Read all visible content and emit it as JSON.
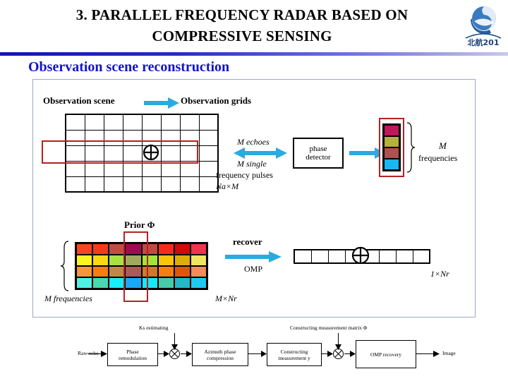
{
  "header": {
    "title_line1": "3. PARALLEL FREQUENCY RADAR BASED ON",
    "title_line2": "COMPRESSIVE SENSING",
    "logo_text": "北航201",
    "logo_name": "beihang-logo",
    "rule_color": "#1414b4"
  },
  "section": {
    "heading": "Observation scene reconstruction",
    "heading_color": "#1414c8"
  },
  "diagram": {
    "labels": {
      "observation_scene": "Observation scene",
      "observation_grids": "Observation grids",
      "m_echoes": "M  echoes",
      "m_single": "M  single",
      "frequency_pulses": "frequency pulses",
      "na_x_m": "Na×M",
      "phase_detector_line1": "phase",
      "phase_detector_line2": "detector",
      "m_frequencies_top": "M",
      "m_frequencies_bottom": "frequencies",
      "prior_phi": "Prior Φ",
      "m_frequencies_left": "M frequencies",
      "m_x_nr": "M×Nr",
      "recover": "recover",
      "omp": "OMP",
      "one_x_nr": "1×Nr"
    },
    "scene_grid": {
      "cols": 8,
      "rows": 5,
      "target_col": 5,
      "target_row": 3
    },
    "result_row": {
      "cols": 8,
      "target_col": 5
    },
    "arrow_color": "#2aaae0",
    "red_box_color": "#b22222",
    "freq_column_colors": [
      "#c2185b",
      "#b5b040",
      "#b0504f",
      "#1ab8f0"
    ],
    "prior_matrix": {
      "cols": 8,
      "rows": 4,
      "colors": [
        [
          "#f8461e",
          "#f53c14",
          "#bf4f46",
          "#a10a53",
          "#bf4a44",
          "#f52d16",
          "#d20a05",
          "#f23251"
        ],
        [
          "#fbf421",
          "#f9d913",
          "#a8e343",
          "#9faa60",
          "#a6e337",
          "#f8c50c",
          "#ddae09",
          "#efe560"
        ],
        [
          "#f5963e",
          "#f77d13",
          "#c08848",
          "#ac5a58",
          "#d2772e",
          "#f57d14",
          "#e2540d",
          "#f28c5c"
        ],
        [
          "#4ff2e2",
          "#49d9ac",
          "#16eefb",
          "#19a9f5",
          "#17e9f8",
          "#45cba8",
          "#22b8c8",
          "#1ecaf2"
        ]
      ],
      "highlight_col": 4
    }
  },
  "flowchart": {
    "input_label": "Raw echo",
    "output_label": "Image",
    "boxes": [
      {
        "name": "phase-remodulation",
        "line1": "Phase",
        "line2": "remodulation"
      },
      {
        "name": "azimuth-phase-compression",
        "line1": "Azimuth phase",
        "line2": "compression"
      },
      {
        "name": "constructing-measurement",
        "line1": "Constructing",
        "line2": "measurement y"
      },
      {
        "name": "omp-recovery",
        "line1": "OMP recovery",
        "line2": ""
      }
    ],
    "annotations": [
      {
        "name": "ks-estimating",
        "text": "Ks estimating"
      },
      {
        "name": "constructing-measurement-matrix",
        "text": "Constructing measurement matrix Φ"
      }
    ]
  }
}
